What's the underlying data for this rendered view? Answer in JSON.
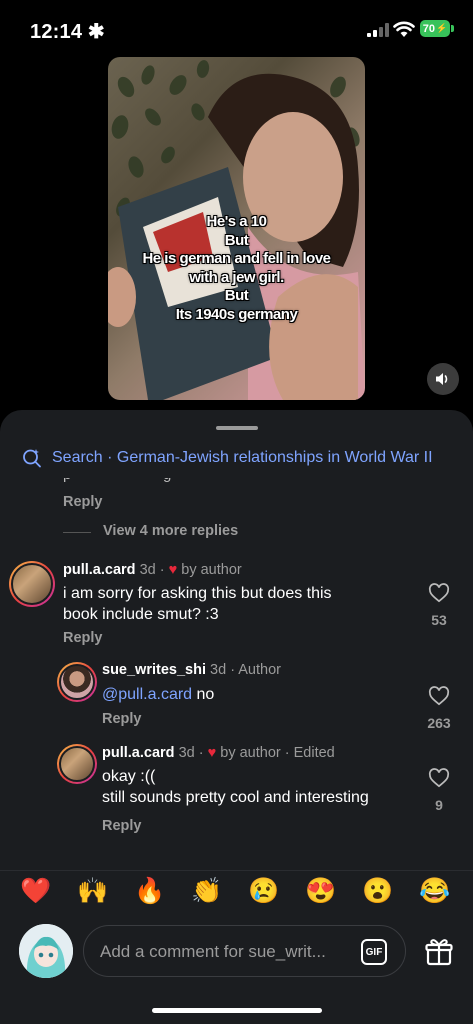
{
  "status_bar": {
    "time": "12:14",
    "battery": "70"
  },
  "video": {
    "caption_lines": [
      "He's a 10",
      "But",
      "He is german and fell in love",
      "with a jew girl.",
      "But",
      "Its 1940s germany"
    ]
  },
  "search": {
    "text": "Search · German-Jewish relationships in World War II"
  },
  "thread": {
    "partial_reply_label": "Reply",
    "view_more": "View 4 more replies"
  },
  "comments": [
    {
      "user": "pull.a.card",
      "age": "3d",
      "tag": "by author",
      "edited": "",
      "text_lines": [
        "i am sorry for asking this but does this",
        "book include smut? :3"
      ],
      "reply": "Reply",
      "likes": "53"
    },
    {
      "user": "sue_writes_shi",
      "age": "3d",
      "tag": "Author",
      "mention": "@pull.a.card",
      "text": " no",
      "reply": "Reply",
      "likes": "263"
    },
    {
      "user": "pull.a.card",
      "age": "3d",
      "tag": "by author",
      "edited": "Edited",
      "text_lines": [
        "okay :((",
        "still sounds pretty cool and interesting"
      ],
      "reply": "Reply",
      "likes": "9"
    }
  ],
  "reactions": [
    "❤️",
    "🙌",
    "🔥",
    "👏",
    "😢",
    "😍",
    "😮",
    "😂"
  ],
  "composer": {
    "placeholder": "Add a comment for sue_writ...",
    "gif_label": "GIF"
  },
  "colors": {
    "accent_link": "#7fa4ff",
    "sheet_bg": "#1b1d20",
    "heart_red": "#e8283b",
    "battery_green": "#38c25a"
  }
}
